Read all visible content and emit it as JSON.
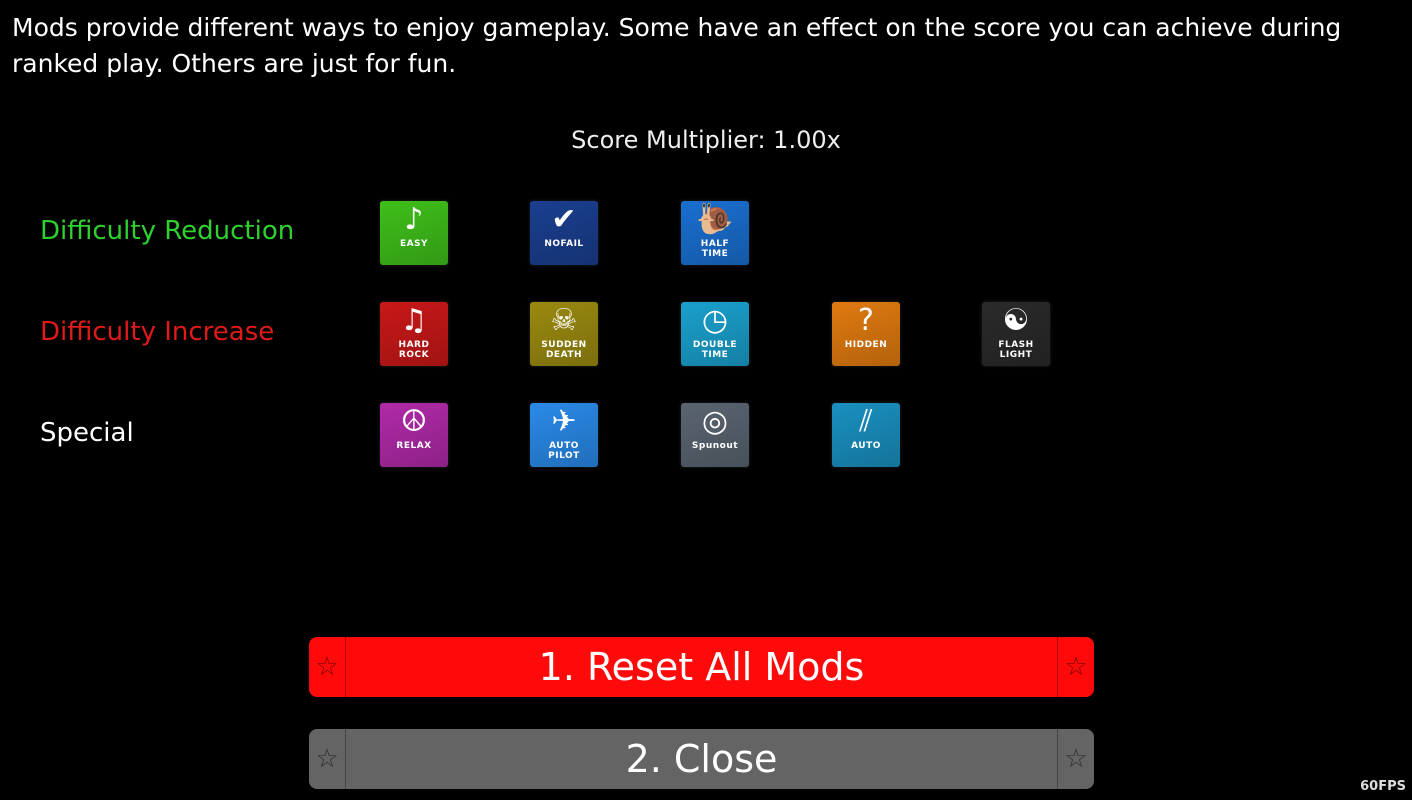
{
  "description": "Mods provide different ways to enjoy gameplay. Some have an effect on the score you can achieve during ranked play. Others are just for fun.",
  "score_multiplier": "Score Multiplier: 1.00x",
  "categories": [
    {
      "label": "Difficulty Reduction",
      "color": "#2ed12e",
      "mods": [
        {
          "label": "EASY",
          "icon": "music-note-icon",
          "glyph": "♪",
          "color": "#3fbf1a"
        },
        {
          "label": "NOFAIL",
          "icon": "checkmark-icon",
          "glyph": "✔",
          "color": "#1a3f8f"
        },
        {
          "label": "HALF\nTIME",
          "icon": "snail-icon",
          "glyph": "🐌",
          "color": "#1a6fd0"
        }
      ]
    },
    {
      "label": "Difficulty Increase",
      "color": "#e01a1a",
      "mods": [
        {
          "label": "HARD\nROCK",
          "icon": "music-notes-icon",
          "glyph": "♫",
          "color": "#c81818"
        },
        {
          "label": "SUDDEN\nDEATH",
          "icon": "skull-icon",
          "glyph": "☠",
          "color": "#9a8a10"
        },
        {
          "label": "DOUBLE\nTIME",
          "icon": "clock-icon",
          "glyph": "◷",
          "color": "#1aa0cc"
        },
        {
          "label": "HIDDEN",
          "icon": "question-mark-icon",
          "glyph": "?",
          "color": "#e07a10"
        },
        {
          "label": "FLASH\nLIGHT",
          "icon": "yin-yang-icon",
          "glyph": "☯",
          "color": "#2a2a2a"
        }
      ]
    },
    {
      "label": "Special",
      "color": "#ffffff",
      "mods": [
        {
          "label": "RELAX",
          "icon": "peace-icon",
          "glyph": "☮",
          "color": "#b02aa8"
        },
        {
          "label": "AUTO\nPILOT",
          "icon": "airplane-icon",
          "glyph": "✈",
          "color": "#2a8ae8"
        },
        {
          "label": "Spunout",
          "icon": "spinner-icon",
          "glyph": "◎",
          "color": "#5a6470"
        },
        {
          "label": "AUTO",
          "icon": "auto-bars-icon",
          "glyph": "⫽",
          "color": "#1a90c0"
        }
      ]
    }
  ],
  "buttons": {
    "reset": {
      "label": "1. Reset All Mods",
      "color": "#ff0a0a"
    },
    "close": {
      "label": "2. Close",
      "color": "#646464"
    }
  },
  "fps": "60FPS"
}
